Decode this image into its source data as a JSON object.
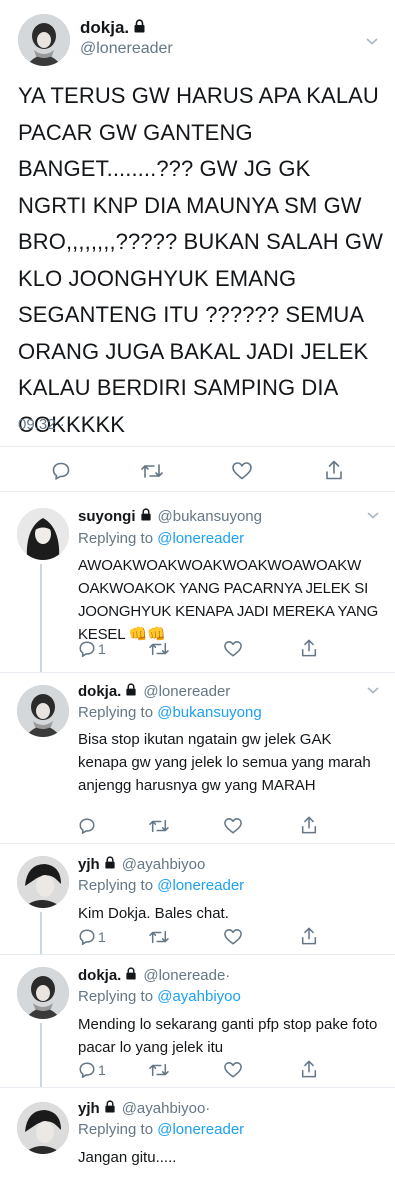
{
  "main_tweet": {
    "name": "dokja.",
    "handle": "@lonereader",
    "text": "YA TERUS GW HARUS APA KALAU PACAR GW GANTENG BANGET........??? GW JG GK NGRTI KNP DIA MAUNYA SM GW BRO,,,,,,,,????? BUKAN SALAH GW KLO JOONGHYUK EMANG SEGANTENG ITU ?????? SEMUA ORANG JUGA BAKAL JADI JELEK KALAU BERDIRI SAMPING DIA COKKKKK",
    "time": "09.32 ·"
  },
  "replies": [
    {
      "name": "suyongi",
      "handle": "@bukansuyong",
      "replying_prefix": "Replying to",
      "replying_to": "@lonereader",
      "text": "AWOAKWOAKWOAKWOAKWOAWOAKW OAKWOAKOK YANG PACARNYA JELEK SI JOONGHYUK KENAPA JADI MEREKA YANG KESEL 👊👊",
      "reply_count": "1"
    },
    {
      "name": "dokja.",
      "handle": "@lonereader",
      "replying_prefix": "Replying to",
      "replying_to": "@bukansuyong",
      "text": "Bisa stop ikutan ngatain gw jelek GAK kenapa gw yang jelek lo semua yang marah anjengg harusnya gw yang MARAH",
      "reply_count": ""
    },
    {
      "name": "yjh",
      "handle": "@ayahbiyoo",
      "replying_prefix": "Replying to",
      "replying_to": "@lonereader",
      "text": "Kim Dokja. Bales chat.",
      "reply_count": "1"
    },
    {
      "name": "dokja.",
      "handle": "@lonereade·",
      "replying_prefix": "Replying to",
      "replying_to": "@ayahbiyoo",
      "text": "Mending lo sekarang ganti pfp stop pake foto pacar lo yang jelek itu",
      "reply_count": "1"
    },
    {
      "name": "yjh",
      "handle": "@ayahbiyoo·",
      "replying_prefix": "Replying to",
      "replying_to": "@lonereader",
      "text": "Jangan gitu.....",
      "reply_count": ""
    }
  ],
  "icons": {
    "reply": "speech-bubble-icon",
    "retweet": "retweet-icon",
    "like": "heart-icon",
    "share": "share-icon",
    "lock": "lock-icon",
    "chevron": "chevron-down-icon"
  },
  "colors": {
    "text": "#14171a",
    "secondary": "#657786",
    "link": "#1da1f2",
    "divider": "#e6ecf0"
  }
}
